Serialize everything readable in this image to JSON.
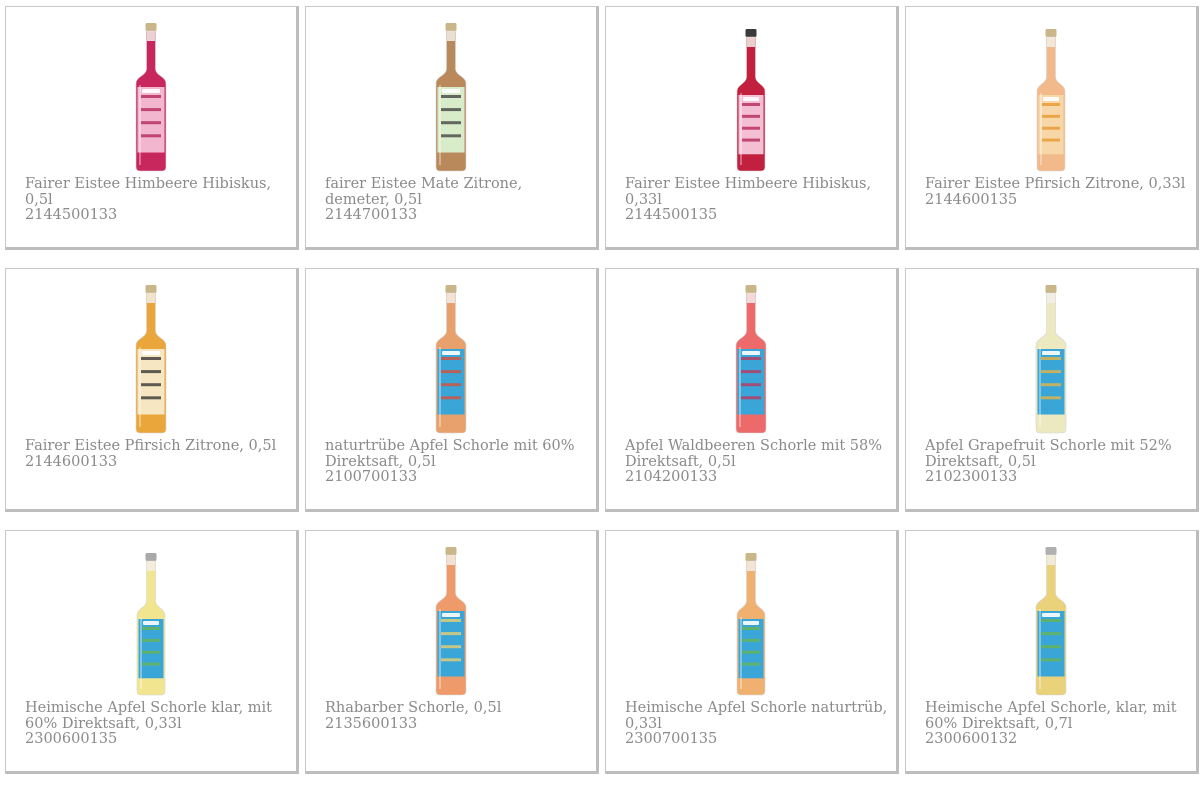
{
  "products": [
    {
      "name": "Fairer Eistee Himbeere Hibiskus, 0,5l",
      "code": "2144500133",
      "bottle": {
        "liquid": "#c8275d",
        "label": "#f2b7cf",
        "accent": "#b21f52",
        "cap": "#c9b78a",
        "shape": "tall"
      }
    },
    {
      "name": "fairer Eistee Mate Zitrone, demeter, 0,5l",
      "code": "2144700133",
      "bottle": {
        "liquid": "#b9895b",
        "label": "#d9ecc9",
        "accent": "#3b3b3b",
        "cap": "#c9b78a",
        "shape": "tall"
      }
    },
    {
      "name": "Fairer Eistee Himbeere Hibiskus, 0,33l",
      "code": "2144500135",
      "bottle": {
        "liquid": "#c2203f",
        "label": "#f4bfd3",
        "accent": "#b21f52",
        "cap": "#3a3a3a",
        "shape": "short"
      }
    },
    {
      "name": "Fairer Eistee Pfirsich Zitrone, 0,33l",
      "code": "2144600135",
      "bottle": {
        "liquid": "#f2b98a",
        "label": "#f7d7a8",
        "accent": "#e8962b",
        "cap": "#c9b78a",
        "shape": "short"
      }
    },
    {
      "name": "Fairer Eistee Pfirsich Zitrone, 0,5l",
      "code": "2144600133",
      "bottle": {
        "liquid": "#eba63b",
        "label": "#f6e6c2",
        "accent": "#2b2b2b",
        "cap": "#c9b78a",
        "shape": "tall"
      }
    },
    {
      "name": "naturtrübe Apfel Schorle mit 60% Direktsaft, 0,5l",
      "code": "2100700133",
      "bottle": {
        "liquid": "#e8a06c",
        "label": "#3aa6d8",
        "accent": "#e14a2f",
        "cap": "#c9b78a",
        "shape": "tall"
      }
    },
    {
      "name": "Apfel Waldbeeren Schorle mit 58% Direktsaft, 0,5l",
      "code": "2104200133",
      "bottle": {
        "liquid": "#ec6a6a",
        "label": "#3aa6d8",
        "accent": "#c43057",
        "cap": "#c9b78a",
        "shape": "tall"
      }
    },
    {
      "name": "Apfel Grapefruit Schorle mit 52% Direktsaft, 0,5l",
      "code": "2102300133",
      "bottle": {
        "liquid": "#ece8c0",
        "label": "#3aa6d8",
        "accent": "#f0b43a",
        "cap": "#c9b78a",
        "shape": "tall"
      }
    },
    {
      "name": "Heimische Apfel Schorle klar, mit 60% Direktsaft, 0,33l",
      "code": "2300600135",
      "bottle": {
        "liquid": "#f1e58f",
        "label": "#3aa6d8",
        "accent": "#6bb54a",
        "cap": "#a9a9a9",
        "shape": "short"
      }
    },
    {
      "name": "Rhabarber Schorle, 0,5l",
      "code": "2135600133",
      "bottle": {
        "liquid": "#ee9a6a",
        "label": "#3aa6d8",
        "accent": "#f3d26a",
        "cap": "#c9b78a",
        "shape": "tall"
      }
    },
    {
      "name": "Heimische Apfel Schorle naturtrüb, 0,33l",
      "code": "2300700135",
      "bottle": {
        "liquid": "#f0b070",
        "label": "#3aa6d8",
        "accent": "#6bb54a",
        "cap": "#c9b78a",
        "shape": "short"
      }
    },
    {
      "name": "Heimische Apfel Schorle, klar, mit 60% Direktsaft, 0,7l",
      "code": "2300600132",
      "bottle": {
        "liquid": "#e9d27a",
        "label": "#3aa6d8",
        "accent": "#6bb54a",
        "cap": "#b0b0b0",
        "shape": "tall"
      }
    }
  ]
}
